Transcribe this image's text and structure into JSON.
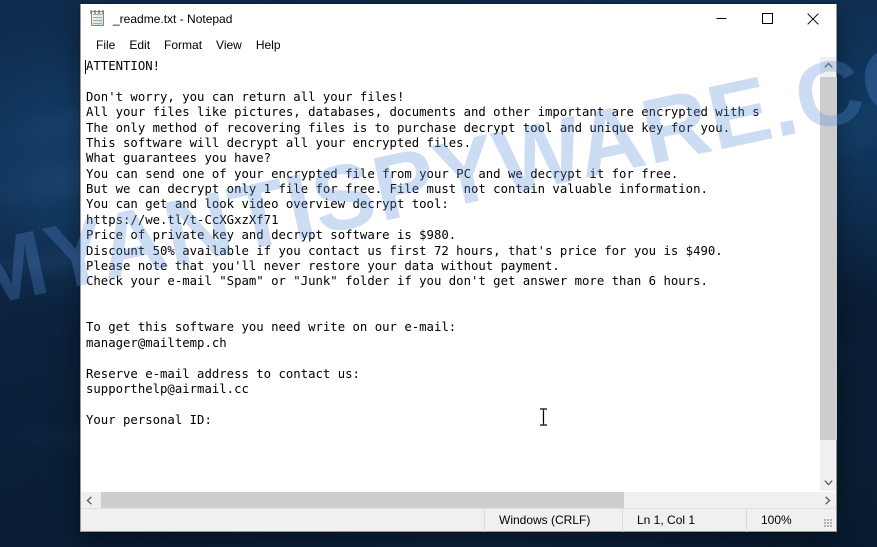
{
  "window": {
    "title": "_readme.txt - Notepad",
    "icon": "notepad-icon",
    "controls": {
      "minimize": "—",
      "maximize": "□",
      "close": "✕"
    }
  },
  "menu": {
    "items": [
      {
        "label": "File"
      },
      {
        "label": "Edit"
      },
      {
        "label": "Format"
      },
      {
        "label": "View"
      },
      {
        "label": "Help"
      }
    ]
  },
  "document": {
    "filename": "_readme.txt",
    "text": "ATTENTION!\n\nDon't worry, you can return all your files!\nAll your files like pictures, databases, documents and other important are encrypted with s\nThe only method of recovering files is to purchase decrypt tool and unique key for you.\nThis software will decrypt all your encrypted files.\nWhat guarantees you have?\nYou can send one of your encrypted file from your PC and we decrypt it for free.\nBut we can decrypt only 1 file for free. File must not contain valuable information.\nYou can get and look video overview decrypt tool:\nhttps://we.tl/t-CcXGxzXf71\nPrice of private key and decrypt software is $980.\nDiscount 50% available if you contact us first 72 hours, that's price for you is $490.\nPlease note that you'll never restore your data without payment.\nCheck your e-mail \"Spam\" or \"Junk\" folder if you don't get answer more than 6 hours.\n\n\nTo get this software you need write on our e-mail:\nmanager@mailtemp.ch\n\nReserve e-mail address to contact us:\nsupporthelp@airmail.cc\n\nYour personal ID:",
    "lines": [
      "ATTENTION!",
      "",
      "Don't worry, you can return all your files!",
      "All your files like pictures, databases, documents and other important are encrypted with s",
      "The only method of recovering files is to purchase decrypt tool and unique key for you.",
      "This software will decrypt all your encrypted files.",
      "What guarantees you have?",
      "You can send one of your encrypted file from your PC and we decrypt it for free.",
      "But we can decrypt only 1 file for free. File must not contain valuable information.",
      "You can get and look video overview decrypt tool:",
      "https://we.tl/t-CcXGxzXf71",
      "Price of private key and decrypt software is $980.",
      "Discount 50% available if you contact us first 72 hours, that's price for you is $490.",
      "Please note that you'll never restore your data without payment.",
      "Check your e-mail \"Spam\" or \"Junk\" folder if you don't get answer more than 6 hours.",
      "",
      "",
      "To get this software you need write on our e-mail:",
      "manager@mailtemp.ch",
      "",
      "Reserve e-mail address to contact us:",
      "supporthelp@airmail.cc",
      "",
      "Your personal ID:"
    ],
    "ransom_details": {
      "price_full": "$980",
      "price_discounted": "$490",
      "discount_percent": "50%",
      "discount_window_hours": "72 hours",
      "response_time": "6 hours",
      "video_url": "https://we.tl/t-CcXGxzXf71",
      "primary_email": "manager@mailtemp.ch",
      "reserve_email": "supporthelp@airmail.cc"
    }
  },
  "statusbar": {
    "encoding": "Windows (CRLF)",
    "position": "Ln 1, Col 1",
    "zoom": "100%"
  },
  "scrollbars": {
    "vertical_up_icon": "⌃",
    "vertical_down_icon": "⌄",
    "horizontal_left_icon": "‹",
    "horizontal_right_icon": "›"
  },
  "desktop": {
    "watermark": "MYANTISPYWARE.COM",
    "watermark_color": "#568cd8",
    "background_color": "#0a2039"
  }
}
